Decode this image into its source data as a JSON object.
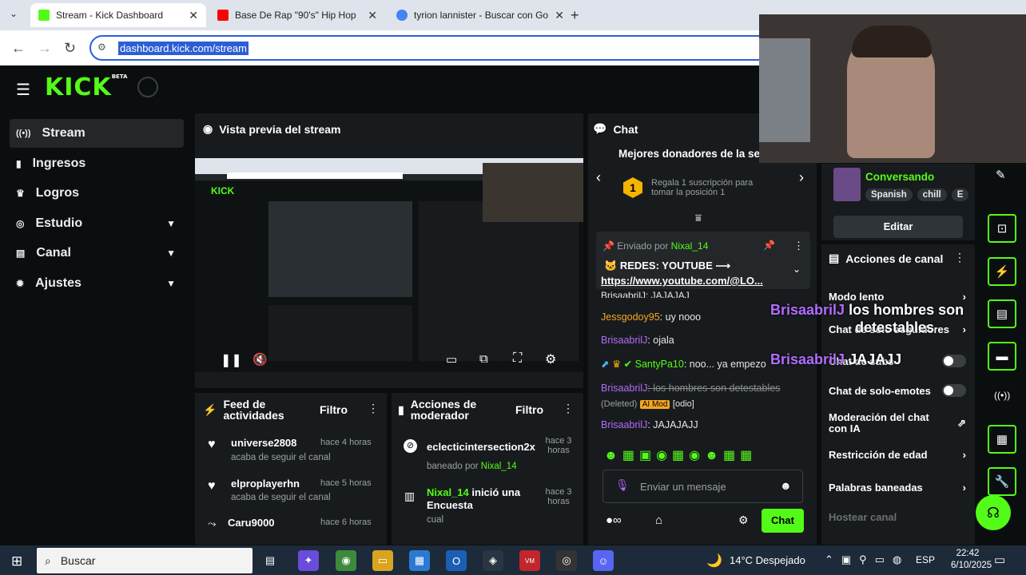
{
  "browser": {
    "tabs": [
      {
        "title": "Stream - Kick Dashboard",
        "color": "#53fc18"
      },
      {
        "title": "Base De Rap \"90's\" Hip Hop",
        "color": "#ff0000"
      },
      {
        "title": "tyrion lannister - Buscar con Go",
        "color": "#4285f4"
      }
    ],
    "url": "dashboard.kick.com/stream"
  },
  "logo": {
    "text": "KICK",
    "badge": "BETA"
  },
  "sidebar": {
    "items": [
      {
        "label": "Stream",
        "icon": "broadcast-icon",
        "glyph": "((•))"
      },
      {
        "label": "Ingresos",
        "icon": "chart-icon",
        "glyph": "▮"
      },
      {
        "label": "Logros",
        "icon": "trophy-icon",
        "glyph": "♛"
      },
      {
        "label": "Estudio",
        "icon": "studio-icon",
        "glyph": "◎"
      },
      {
        "label": "Canal",
        "icon": "channel-icon",
        "glyph": "▤"
      },
      {
        "label": "Ajustes",
        "icon": "gear-icon",
        "glyph": "✹"
      }
    ]
  },
  "preview": {
    "title": "Vista previa del stream"
  },
  "activity": {
    "title": "Feed de actividades",
    "filter": "Filtro",
    "items": [
      {
        "user": "universe2808",
        "time": "hace 4 horas",
        "text": "acaba de seguir el canal"
      },
      {
        "user": "elproplayerhn",
        "time": "hace 5 horas",
        "text": "acaba de seguir el canal"
      },
      {
        "user": "Caru9000",
        "time": "hace 6 horas",
        "text": ""
      }
    ]
  },
  "modactions": {
    "title": "Acciones de moderador",
    "filter": "Filtro",
    "items": [
      {
        "user": "eclecticintersection2x",
        "time": "hace 3 horas",
        "sub": "baneado por",
        "by": "Nixal_14"
      },
      {
        "user": "Nixal_14",
        "action": "inició una Encuesta",
        "time": "hace 3 horas",
        "sub": "cual"
      }
    ]
  },
  "chat": {
    "title": "Chat",
    "donors_title": "Mejores donadores de la se",
    "donor_rank": "1",
    "donor_text": "Regala 1 suscripción para tomar la posición 1",
    "pinned_by": "Enviado por",
    "pinned_user": "Nixal_14",
    "pinned_msg": "REDES: YOUTUBE ⟶",
    "pinned_link": "https://www.youtube.com/@LO...",
    "messages": [
      {
        "user": "Jessgodoy95",
        "text": ": uy nooo"
      },
      {
        "user": "BrisaabrilJ",
        "text": ": ojala"
      },
      {
        "user": "SantyPa10",
        "text": ": noo... ya empezo"
      },
      {
        "user": "BrisaabrilJ",
        "text": ": los hombres son detestables",
        "deleted": "(Deleted)",
        "tag": "AI Mod",
        "extra": "[odio]"
      },
      {
        "user": "BrisaabrilJ",
        "text": ": JAJAJAJJ"
      }
    ],
    "partial_msg": "BrisaabrilJ: JAJAJAJ",
    "input_placeholder": "Enviar un mensaje",
    "send_label": "Chat"
  },
  "stream_info": {
    "category": "Conversando",
    "tags": [
      "Spanish",
      "chill",
      "E"
    ],
    "edit_label": "Editar"
  },
  "channel_actions": {
    "title": "Acciones de canal",
    "rows": [
      {
        "label": "Modo lento",
        "control": "chevron"
      },
      {
        "label": "Chat de solo seguidores",
        "control": "chevron"
      },
      {
        "label": "Chat de subs",
        "control": "toggle"
      },
      {
        "label": "Chat de solo-emotes",
        "control": "toggle"
      },
      {
        "label": "Moderación del chat con IA",
        "control": "link"
      },
      {
        "label": "Restricción de edad",
        "control": "chevron"
      },
      {
        "label": "Palabras baneadas",
        "control": "chevron"
      },
      {
        "label": "Hostear canal",
        "control": "none"
      }
    ]
  },
  "overlay": {
    "line1": "BrisaabrilJ",
    "line1b": "los hombres son",
    "line2": "detestables",
    "line3a": "BrisaabrilJ",
    "line3b": "JAJAJJ"
  },
  "taskbar": {
    "search": "Buscar",
    "weather": "14°C  Despejado",
    "lang": "ESP",
    "time": "22:42",
    "date": "6/10/2025"
  }
}
